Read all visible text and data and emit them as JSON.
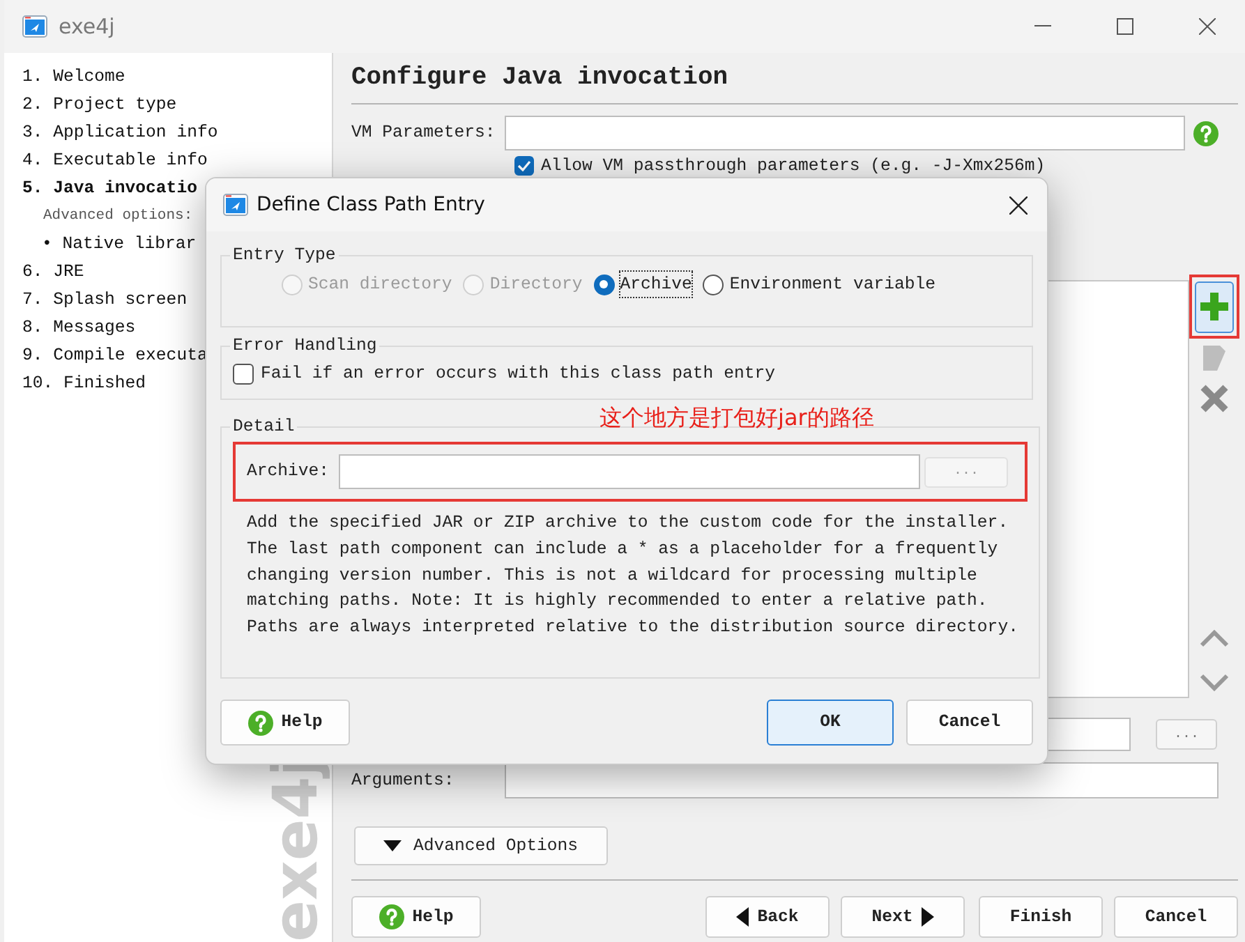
{
  "window": {
    "title": "exe4j"
  },
  "sidebar": {
    "items": [
      {
        "kind": "step",
        "label": "1. Welcome",
        "selected": false
      },
      {
        "kind": "step",
        "label": "2. Project type",
        "selected": false
      },
      {
        "kind": "step",
        "label": "3. Application info",
        "selected": false
      },
      {
        "kind": "step",
        "label": "4. Executable info",
        "selected": false
      },
      {
        "kind": "step",
        "label": "5. Java invocatio",
        "selected": true
      },
      {
        "kind": "subheading",
        "label": "Advanced options:",
        "selected": false
      },
      {
        "kind": "subitem",
        "label": "• Native librar",
        "selected": false
      },
      {
        "kind": "step",
        "label": "6. JRE",
        "selected": false
      },
      {
        "kind": "step",
        "label": "7. Splash screen",
        "selected": false
      },
      {
        "kind": "step",
        "label": "8. Messages",
        "selected": false
      },
      {
        "kind": "step",
        "label": "9. Compile executa",
        "selected": false
      },
      {
        "kind": "step",
        "label": "10. Finished",
        "selected": false
      }
    ],
    "logo": "exe4j"
  },
  "page": {
    "title": "Configure Java invocation",
    "vm_parameters_label": "VM Parameters:",
    "passthrough": {
      "label": "Allow VM passthrough parameters (e.g. -J-Xmx256m)",
      "checked": true
    },
    "browse_button": "...",
    "arguments_label": "Arguments:",
    "advanced_button": "Advanced Options",
    "buttons": [
      {
        "kind": "help",
        "label": "Help"
      },
      {
        "kind": "back",
        "label": "Back"
      },
      {
        "kind": "next",
        "label": "Next"
      },
      {
        "kind": "plain",
        "label": "Finish"
      },
      {
        "kind": "plain",
        "label": "Cancel"
      }
    ]
  },
  "dialog": {
    "title": "Define Class Path Entry",
    "entry_type": {
      "legend": "Entry Type",
      "options": [
        {
          "label": "Scan directory",
          "selected": false,
          "disabled": true,
          "focused": false
        },
        {
          "label": "Directory",
          "selected": false,
          "disabled": true,
          "focused": false
        },
        {
          "label": "Archive",
          "selected": true,
          "disabled": false,
          "focused": true
        },
        {
          "label": "Environment variable",
          "selected": false,
          "disabled": false,
          "focused": false
        }
      ]
    },
    "error_handling": {
      "legend": "Error Handling",
      "option": {
        "label": "Fail if an error occurs with this class path entry",
        "checked": false
      }
    },
    "detail": {
      "legend": "Detail",
      "archive_label": "Archive:",
      "browse_button": "...",
      "description": "Add the specified JAR or ZIP archive to the custom code for the installer. The last path component can include a * as a placeholder for a frequently changing version number. This is not a wildcard for processing multiple matching paths. Note: It is highly recommended to enter a relative path. Paths are always interpreted relative to the distribution source directory."
    },
    "buttons": [
      {
        "kind": "help",
        "label": "Help"
      },
      {
        "kind": "default",
        "label": "OK"
      },
      {
        "kind": "plain",
        "label": "Cancel"
      }
    ]
  },
  "annotation": {
    "text": "这个地方是打包好jar的路径"
  }
}
